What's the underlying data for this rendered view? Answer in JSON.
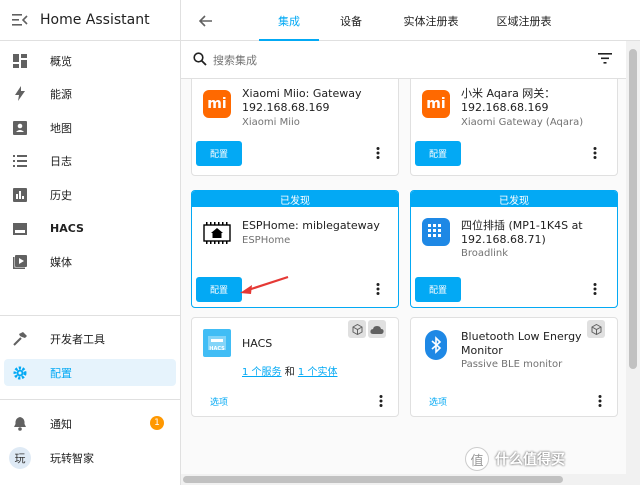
{
  "app": {
    "title": "Home Assistant"
  },
  "sidebar": {
    "items": [
      {
        "label": "概览",
        "icon": "dashboard-icon"
      },
      {
        "label": "能源",
        "icon": "lightning-icon"
      },
      {
        "label": "地图",
        "icon": "map-person-icon"
      },
      {
        "label": "日志",
        "icon": "list-icon"
      },
      {
        "label": "历史",
        "icon": "bar-chart-icon"
      },
      {
        "label": "HACS",
        "icon": "hacs-icon"
      },
      {
        "label": "媒体",
        "icon": "media-icon"
      }
    ],
    "bottom": [
      {
        "label": "开发者工具",
        "icon": "hammer-icon"
      },
      {
        "label": "配置",
        "icon": "gear-icon"
      }
    ],
    "notifications": {
      "label": "通知",
      "count": "1"
    },
    "user": {
      "avatar": "玩",
      "label": "玩转智家"
    }
  },
  "tabs": [
    {
      "label": "集成"
    },
    {
      "label": "设备"
    },
    {
      "label": "实体注册表"
    },
    {
      "label": "区域注册表"
    }
  ],
  "search": {
    "placeholder": "搜索集成"
  },
  "cards": {
    "c1": {
      "title": "Xiaomi Miio: Gateway",
      "ip": "192.168.68.169",
      "sub": "Xiaomi Miio",
      "button": "配置"
    },
    "c2": {
      "title": "小米 Aqara 网关：",
      "ip": "192.168.68.169",
      "sub": "Xiaomi Gateway (Aqara)",
      "button": "配置"
    },
    "c3": {
      "header": "已发现",
      "title": "ESPHome: miblegateway",
      "sub": "ESPHome",
      "button": "配置"
    },
    "c4": {
      "header": "已发现",
      "title": "四位排插 (MP1-1K4S at",
      "ip": "192.168.68.71)",
      "sub": "Broadlink",
      "button": "配置"
    },
    "c5": {
      "title": "HACS",
      "service_link": "1 个服务",
      "and": "和",
      "entity_link": "1 个实体",
      "button": "选项"
    },
    "c6": {
      "title": "Bluetooth Low Energy",
      "title2": "Monitor",
      "sub": "Passive BLE monitor",
      "button": "选项"
    }
  },
  "watermark": {
    "text": "什么值得买",
    "icon": "值"
  },
  "colors": {
    "accent": "#03a9f4",
    "mi_orange": "#ff6900"
  }
}
